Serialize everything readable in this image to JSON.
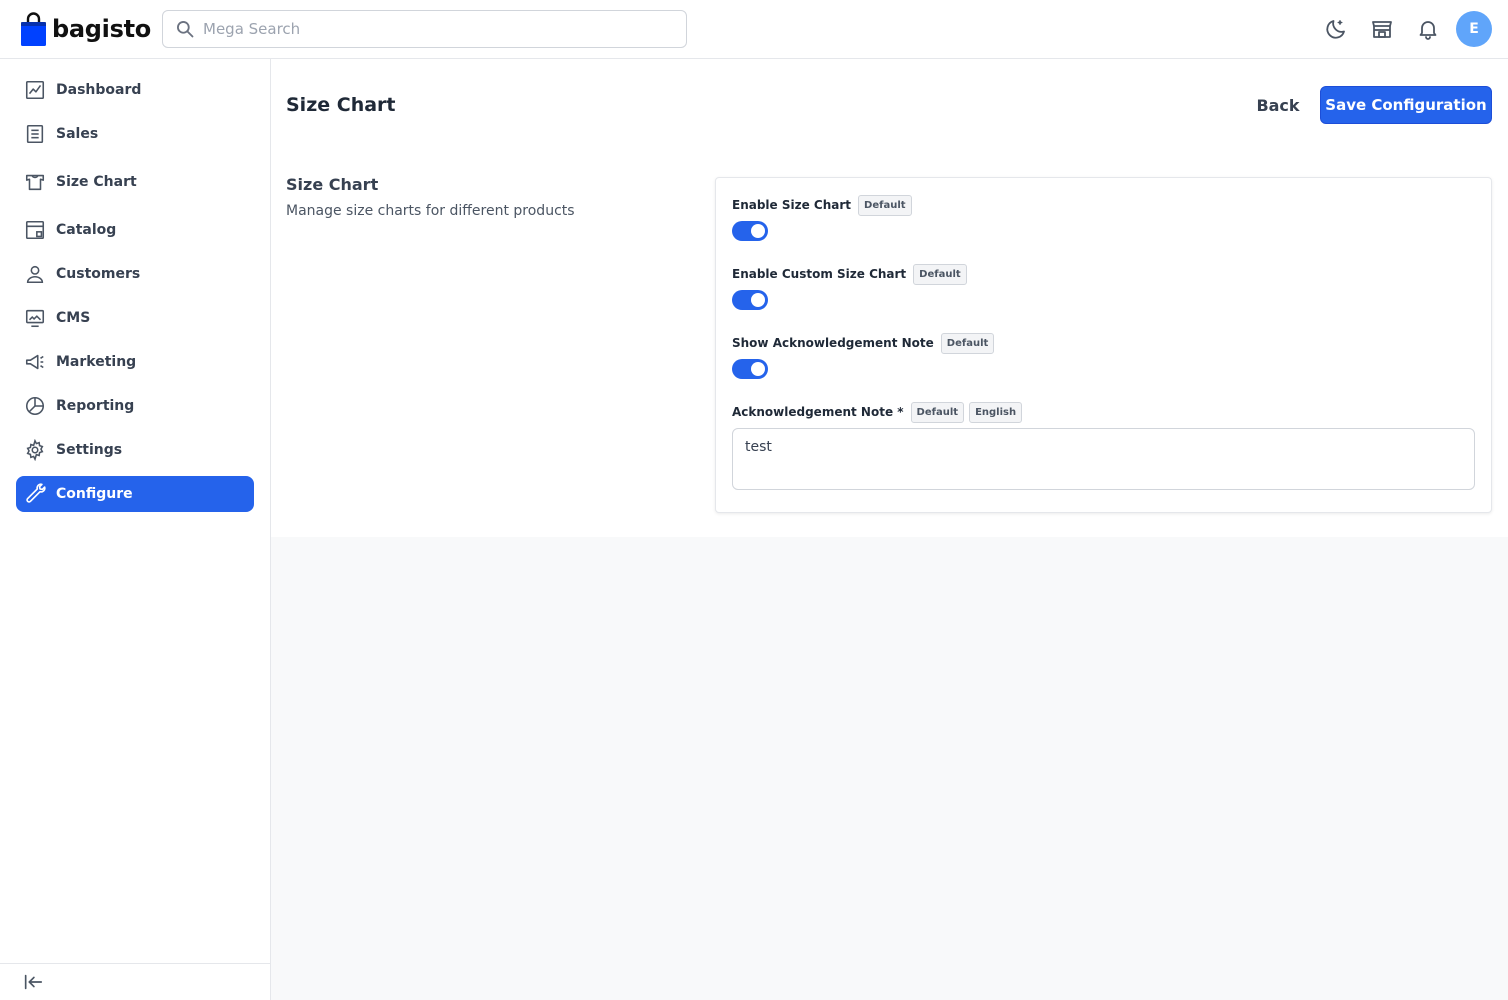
{
  "brand": {
    "name": "bagisto",
    "color": "#0041ff"
  },
  "header": {
    "search_placeholder": "Mega Search",
    "avatar_initial": "E",
    "icons": [
      "dark-mode-icon",
      "storefront-icon",
      "notification-bell-icon"
    ]
  },
  "sidebar": {
    "items": [
      {
        "label": "Dashboard",
        "icon": "dashboard-icon",
        "active": false
      },
      {
        "label": "Sales",
        "icon": "sales-icon",
        "active": false
      },
      {
        "label": "Size Chart",
        "icon": "size-chart-icon",
        "active": false
      },
      {
        "label": "Catalog",
        "icon": "catalog-icon",
        "active": false
      },
      {
        "label": "Customers",
        "icon": "customers-icon",
        "active": false
      },
      {
        "label": "CMS",
        "icon": "cms-icon",
        "active": false
      },
      {
        "label": "Marketing",
        "icon": "marketing-icon",
        "active": false
      },
      {
        "label": "Reporting",
        "icon": "reporting-icon",
        "active": false
      },
      {
        "label": "Settings",
        "icon": "settings-icon",
        "active": false
      },
      {
        "label": "Configure",
        "icon": "configure-icon",
        "active": true
      }
    ],
    "collapse_icon": "collapse-sidebar-icon"
  },
  "page": {
    "title": "Size Chart",
    "back_label": "Back",
    "save_label": "Save Configuration"
  },
  "section": {
    "title": "Size Chart",
    "description": "Manage size charts for different products"
  },
  "fields": {
    "enable_size_chart": {
      "label": "Enable Size Chart",
      "badge": "Default",
      "value": true
    },
    "enable_custom_size_chart": {
      "label": "Enable Custom Size Chart",
      "badge": "Default",
      "value": true
    },
    "show_ack_note": {
      "label": "Show Acknowledgement Note",
      "badge": "Default",
      "value": true
    },
    "ack_note": {
      "label": "Acknowledgement Note *",
      "badge_scope": "Default",
      "badge_locale": "English",
      "value": "test"
    }
  },
  "colors": {
    "accent": "#2563eb",
    "avatar": "#60a5fa"
  }
}
